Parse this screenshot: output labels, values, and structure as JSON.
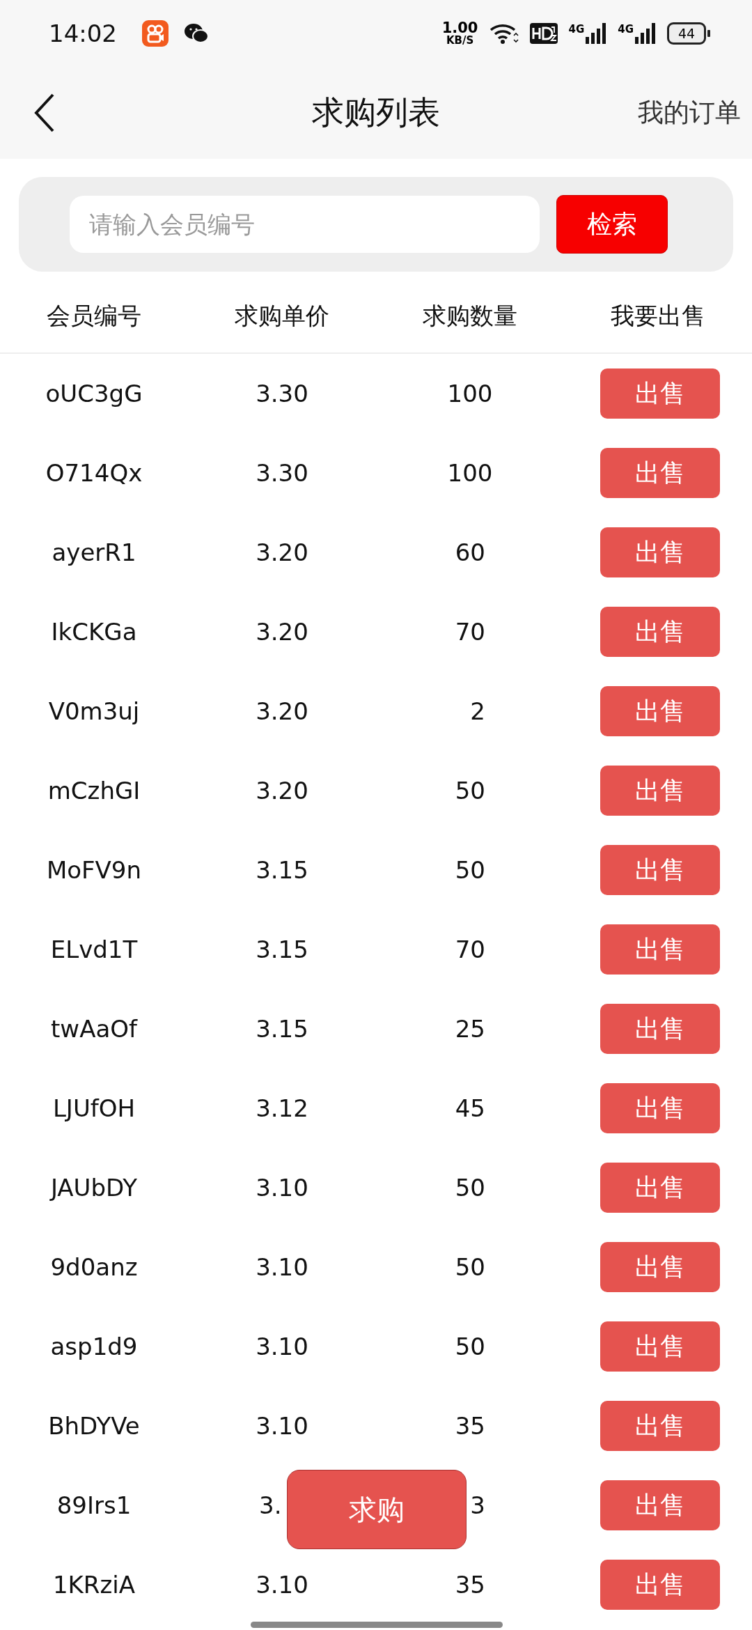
{
  "status_bar": {
    "time": "14:02",
    "net_speed": "1.00",
    "net_unit": "KB/S",
    "battery": "44",
    "sim_labels": [
      "4G",
      "4G"
    ]
  },
  "header": {
    "title": "求购列表",
    "action": "我的订单"
  },
  "search": {
    "placeholder": "请输入会员编号",
    "button": "检索"
  },
  "table": {
    "columns": [
      "会员编号",
      "求购单价",
      "求购数量",
      "我要出售"
    ],
    "rows": [
      {
        "member": "oUC3gG",
        "price": "3.30",
        "quantity": "100",
        "action": "出售"
      },
      {
        "member": "O714Qx",
        "price": "3.30",
        "quantity": "100",
        "action": "出售"
      },
      {
        "member": "ayerR1",
        "price": "3.20",
        "quantity": "60",
        "action": "出售"
      },
      {
        "member": "IkCKGa",
        "price": "3.20",
        "quantity": "70",
        "action": "出售"
      },
      {
        "member": "V0m3uj",
        "price": "3.20",
        "quantity": "2",
        "action": "出售"
      },
      {
        "member": "mCzhGI",
        "price": "3.20",
        "quantity": "50",
        "action": "出售"
      },
      {
        "member": "MoFV9n",
        "price": "3.15",
        "quantity": "50",
        "action": "出售"
      },
      {
        "member": "ELvd1T",
        "price": "3.15",
        "quantity": "70",
        "action": "出售"
      },
      {
        "member": "twAaOf",
        "price": "3.15",
        "quantity": "25",
        "action": "出售"
      },
      {
        "member": "LJUfOH",
        "price": "3.12",
        "quantity": "45",
        "action": "出售"
      },
      {
        "member": "JAUbDY",
        "price": "3.10",
        "quantity": "50",
        "action": "出售"
      },
      {
        "member": "9d0anz",
        "price": "3.10",
        "quantity": "50",
        "action": "出售"
      },
      {
        "member": "asp1d9",
        "price": "3.10",
        "quantity": "50",
        "action": "出售"
      },
      {
        "member": "BhDYVe",
        "price": "3.10",
        "quantity": "35",
        "action": "出售"
      },
      {
        "member": "89Irs1",
        "price": "3.",
        "quantity": "3",
        "action": "出售"
      },
      {
        "member": "1KRziA",
        "price": "3.10",
        "quantity": "35",
        "action": "出售"
      }
    ]
  },
  "float_button": "求购"
}
